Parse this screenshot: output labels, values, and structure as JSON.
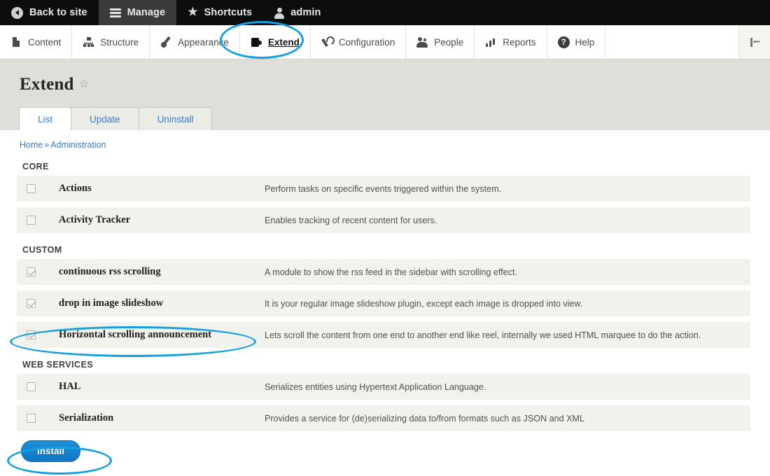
{
  "adminbar": {
    "items": [
      {
        "label": "Back to site",
        "icon": "back-arrow-icon",
        "active": false
      },
      {
        "label": "Manage",
        "icon": "hamburger-menu-icon",
        "active": true
      },
      {
        "label": "Shortcuts",
        "icon": "star-icon",
        "active": false
      },
      {
        "label": "admin",
        "icon": "user-icon",
        "active": false
      }
    ]
  },
  "nav": {
    "items": [
      {
        "label": "Content",
        "icon": "document-icon",
        "current": false
      },
      {
        "label": "Structure",
        "icon": "structure-icon",
        "current": false
      },
      {
        "label": "Appearance",
        "icon": "paintbrush-icon",
        "current": false
      },
      {
        "label": "Extend",
        "icon": "puzzle-piece-icon",
        "current": true
      },
      {
        "label": "Configuration",
        "icon": "wrench-icon",
        "current": false
      },
      {
        "label": "People",
        "icon": "people-icon",
        "current": false
      },
      {
        "label": "Reports",
        "icon": "bar-chart-icon",
        "current": false
      },
      {
        "label": "Help",
        "icon": "question-mark-circle-icon",
        "current": false
      }
    ],
    "collapse_icon": "collapse-sidebar-icon"
  },
  "page": {
    "title": "Extend",
    "favorite_icon": "star-outline-icon",
    "tabs": [
      {
        "label": "List",
        "active": true
      },
      {
        "label": "Update",
        "active": false
      },
      {
        "label": "Uninstall",
        "active": false
      }
    ]
  },
  "breadcrumb": {
    "items": [
      "Home",
      "Administration"
    ],
    "separator": "»"
  },
  "groups": [
    {
      "title": "CORE",
      "modules": [
        {
          "name": "Actions",
          "description": "Perform tasks on specific events triggered within the system.",
          "checked": false
        },
        {
          "name": "Activity Tracker",
          "description": "Enables tracking of recent content for users.",
          "checked": false
        }
      ]
    },
    {
      "title": "CUSTOM",
      "modules": [
        {
          "name": "continuous rss scrolling",
          "description": "A module to show the rss feed in the sidebar with scrolling effect.",
          "checked": true
        },
        {
          "name": "drop in image slideshow",
          "description": "It is your regular image slideshow plugin, except each image is dropped into view.",
          "checked": true
        },
        {
          "name": "Horizontal scrolling announcement",
          "description": "Lets scroll the content from one end to another end like reel, internally we used HTML marquee to do the action.",
          "checked": true
        }
      ]
    },
    {
      "title": "WEB SERVICES",
      "modules": [
        {
          "name": "HAL",
          "description": "Serializes entities using Hypertext Application Language.",
          "checked": false
        },
        {
          "name": "Serialization",
          "description": "Provides a service for (de)serializing data to/from formats such as JSON and XML",
          "checked": false
        }
      ]
    }
  ],
  "actions": {
    "install_label": "Install"
  },
  "colors": {
    "accent_link": "#3b7bbf",
    "annotation": "#12a0e0",
    "button_primary": "#1f8fd6",
    "adminbar_bg": "#0d0d0d",
    "pagehead_bg": "#dfdfd9",
    "row_bg": "#f2f2ec"
  }
}
